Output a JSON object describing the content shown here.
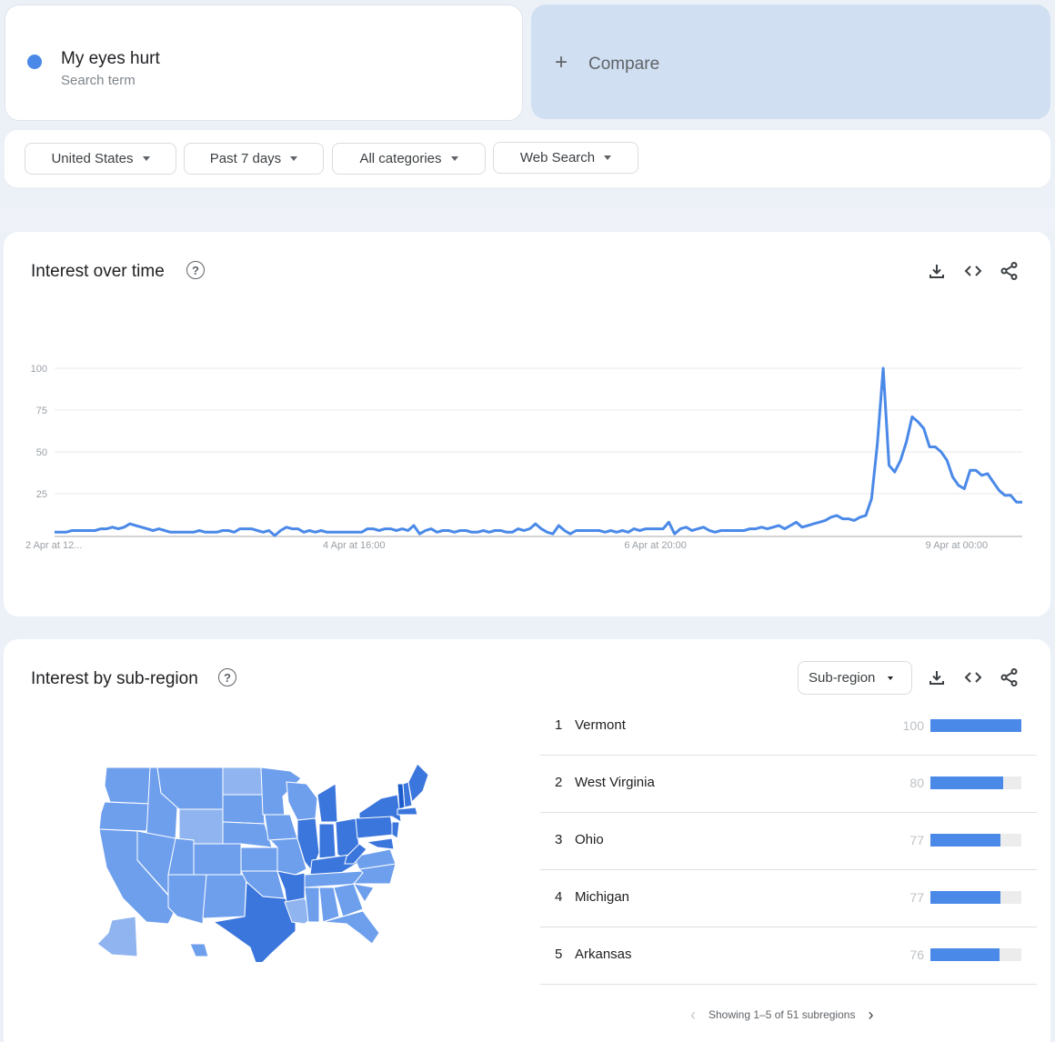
{
  "colors": {
    "accent": "#4a89e8",
    "map_light": "#8fb4f0",
    "map_mid": "#6e9fed",
    "map_dark": "#3b76dd",
    "map_darkest": "#1c5bcc"
  },
  "term": {
    "name": "My eyes hurt",
    "subtitle": "Search term"
  },
  "compare": {
    "icon": "plus-icon",
    "label": "Compare"
  },
  "filters": [
    {
      "label": "United States"
    },
    {
      "label": "Past 7 days"
    },
    {
      "label": "All categories"
    },
    {
      "label": "Web Search"
    }
  ],
  "interest_over_time": {
    "title": "Interest over time",
    "help_icon": "?",
    "tools": [
      "download-icon",
      "embed-code-icon",
      "share-icon"
    ]
  },
  "interest_by_subregion": {
    "title": "Interest by sub-region",
    "help_icon": "?",
    "resolution_select": "Sub-region",
    "tools": [
      "download-icon",
      "embed-code-icon",
      "share-icon"
    ],
    "rows": [
      {
        "rank": "1",
        "name": "Vermont",
        "value": 100
      },
      {
        "rank": "2",
        "name": "West Virginia",
        "value": 80
      },
      {
        "rank": "3",
        "name": "Ohio",
        "value": 77
      },
      {
        "rank": "4",
        "name": "Michigan",
        "value": 77
      },
      {
        "rank": "5",
        "name": "Arkansas",
        "value": 76
      }
    ],
    "pager": {
      "prev": "‹",
      "text": "Showing 1–5 of 51 subregions",
      "next": "›"
    },
    "map": {
      "region": "United States",
      "highlighted": [
        "Vermont",
        "West Virginia",
        "Ohio",
        "Michigan",
        "Arkansas"
      ]
    }
  },
  "chart_data": {
    "type": "line",
    "title": "Interest over time",
    "xlabel": "",
    "ylabel": "",
    "ylim": [
      0,
      100
    ],
    "yticks": [
      25,
      50,
      75,
      100
    ],
    "xtick_labels": [
      {
        "label": "2 Apr at 12...",
        "index": 0
      },
      {
        "label": "4 Apr at 16:00",
        "index": 52
      },
      {
        "label": "6 Apr at 20:00",
        "index": 104
      },
      {
        "label": "9 Apr at 00:00",
        "index": 156
      }
    ],
    "grid": true,
    "series": [
      {
        "name": "My eyes hurt",
        "values": [
          2,
          2,
          2,
          3,
          3,
          3,
          3,
          3,
          4,
          4,
          5,
          4,
          5,
          7,
          6,
          5,
          4,
          3,
          4,
          3,
          2,
          2,
          2,
          2,
          2,
          3,
          2,
          2,
          2,
          3,
          3,
          2,
          4,
          4,
          4,
          3,
          2,
          3,
          0,
          3,
          5,
          4,
          4,
          2,
          3,
          2,
          3,
          2,
          2,
          2,
          2,
          2,
          2,
          2,
          4,
          4,
          3,
          4,
          4,
          3,
          4,
          3,
          6,
          1,
          3,
          4,
          2,
          3,
          3,
          2,
          3,
          3,
          2,
          2,
          3,
          2,
          3,
          3,
          2,
          2,
          4,
          3,
          4,
          7,
          4,
          2,
          1,
          6,
          3,
          1,
          3,
          3,
          3,
          3,
          3,
          2,
          3,
          2,
          3,
          2,
          4,
          3,
          4,
          4,
          4,
          4,
          8,
          1,
          4,
          5,
          3,
          4,
          5,
          3,
          2,
          3,
          3,
          3,
          3,
          3,
          4,
          4,
          5,
          4,
          5,
          6,
          4,
          6,
          8,
          5,
          6,
          7,
          8,
          9,
          11,
          12,
          10,
          10,
          9,
          11,
          12,
          22,
          55,
          100,
          42,
          38,
          45,
          56,
          71,
          68,
          64,
          53,
          53,
          50,
          45,
          35,
          30,
          28,
          39,
          39,
          36,
          37,
          32,
          27,
          24,
          24,
          20,
          20
        ]
      }
    ]
  }
}
